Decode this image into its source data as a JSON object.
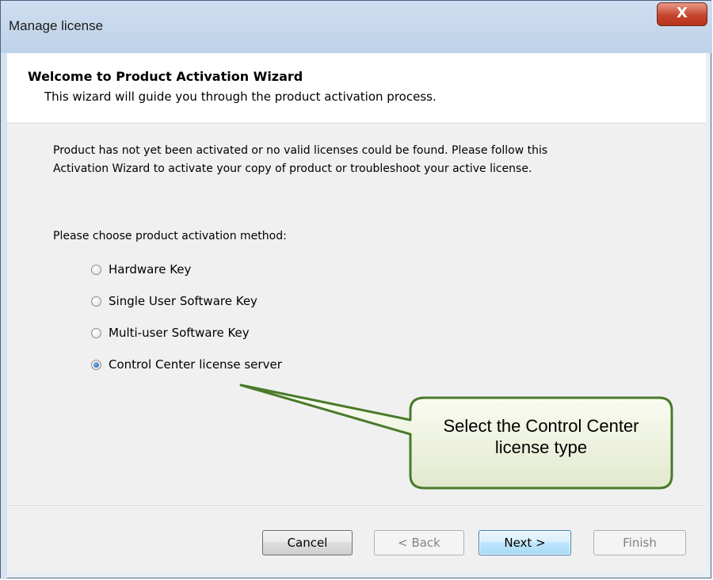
{
  "window": {
    "title": "Manage license",
    "close_glyph": "X"
  },
  "header": {
    "title": "Welcome to Product Activation Wizard",
    "subtitle": "This wizard will guide you through the product activation process."
  },
  "content": {
    "description_line1": "Product has not yet been activated or no valid licenses could be found. Please follow this",
    "description_line2": "Activation Wizard to activate your copy of product or troubleshoot your active license.",
    "prompt": "Please choose product activation method:",
    "options": [
      {
        "label": "Hardware Key",
        "selected": false
      },
      {
        "label": "Single User Software Key",
        "selected": false
      },
      {
        "label": "Multi-user Software Key",
        "selected": false
      },
      {
        "label": "Control Center license server",
        "selected": true
      }
    ]
  },
  "callout": {
    "line1": "Select the Control Center",
    "line2": "license type",
    "border_color": "#4a7a2a"
  },
  "buttons": {
    "cancel": "Cancel",
    "back": "< Back",
    "next": "Next >",
    "finish": "Finish"
  }
}
